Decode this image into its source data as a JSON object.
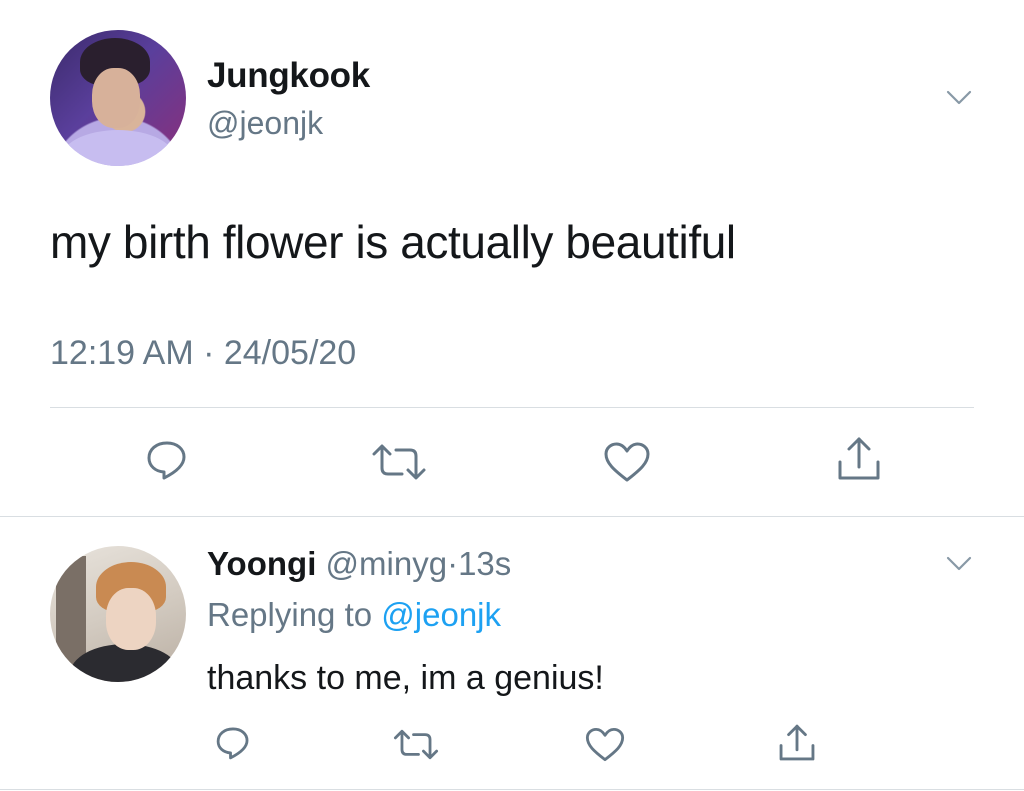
{
  "tweet": {
    "author_name": "Jungkook",
    "author_handle": "@jeonjk",
    "text": "my birth flower is actually beautiful",
    "timestamp": "12:19 AM · 24/05/20",
    "actions": [
      "reply-icon",
      "retweet-icon",
      "like-icon",
      "share-icon"
    ]
  },
  "reply": {
    "author_name": "Yoongi",
    "author_handle": "@minyg",
    "separator": "·",
    "time": "13s",
    "replying_prefix": "Replying to",
    "replying_handle": "@jeonjk",
    "text": "thanks to me, im a genius!",
    "actions": [
      "reply-icon",
      "retweet-icon",
      "like-icon",
      "share-icon"
    ]
  },
  "colors": {
    "text_primary": "#14171a",
    "text_secondary": "#657786",
    "link": "#1da1f2",
    "divider": "#d9dee2"
  }
}
